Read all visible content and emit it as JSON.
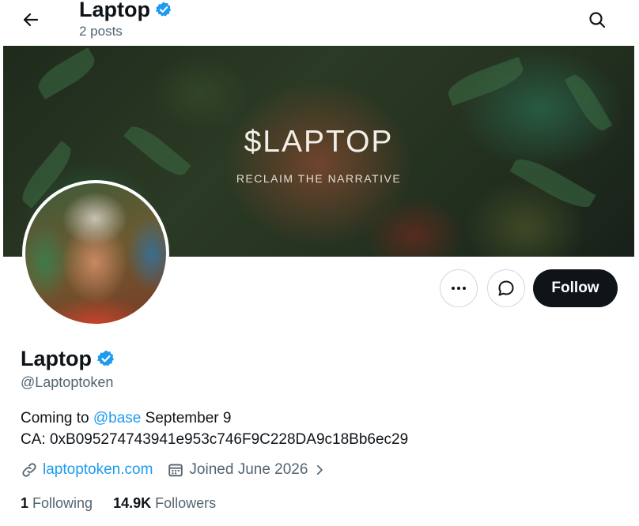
{
  "header": {
    "name": "Laptop",
    "posts": "2 posts"
  },
  "banner": {
    "title": "$LAPTOP",
    "subtitle": "RECLAIM THE NARRATIVE"
  },
  "actions": {
    "follow_label": "Follow"
  },
  "profile": {
    "name": "Laptop",
    "handle": "@Laptoptoken",
    "bio_prefix": "Coming to ",
    "bio_mention": "@base",
    "bio_suffix": " September 9",
    "bio_line2": "CA: 0xB095274743941e953c746F9C228DA9c18Bb6ec29",
    "website": "laptoptoken.com",
    "joined": "Joined June 2026",
    "following_count": "1",
    "following_label": "Following",
    "followers_count": "14.9K",
    "followers_label": "Followers"
  },
  "icons": {
    "back": "arrow-left-icon",
    "search": "search-icon",
    "verified": "verified-badge-icon",
    "more": "more-dots-icon",
    "message": "message-bubble-icon",
    "link": "link-icon",
    "calendar": "calendar-icon",
    "chevron": "chevron-right-icon"
  },
  "colors": {
    "accent": "#1d9bf0",
    "text": "#0f1419",
    "muted": "#536471",
    "follow_bg": "#0f1419"
  }
}
